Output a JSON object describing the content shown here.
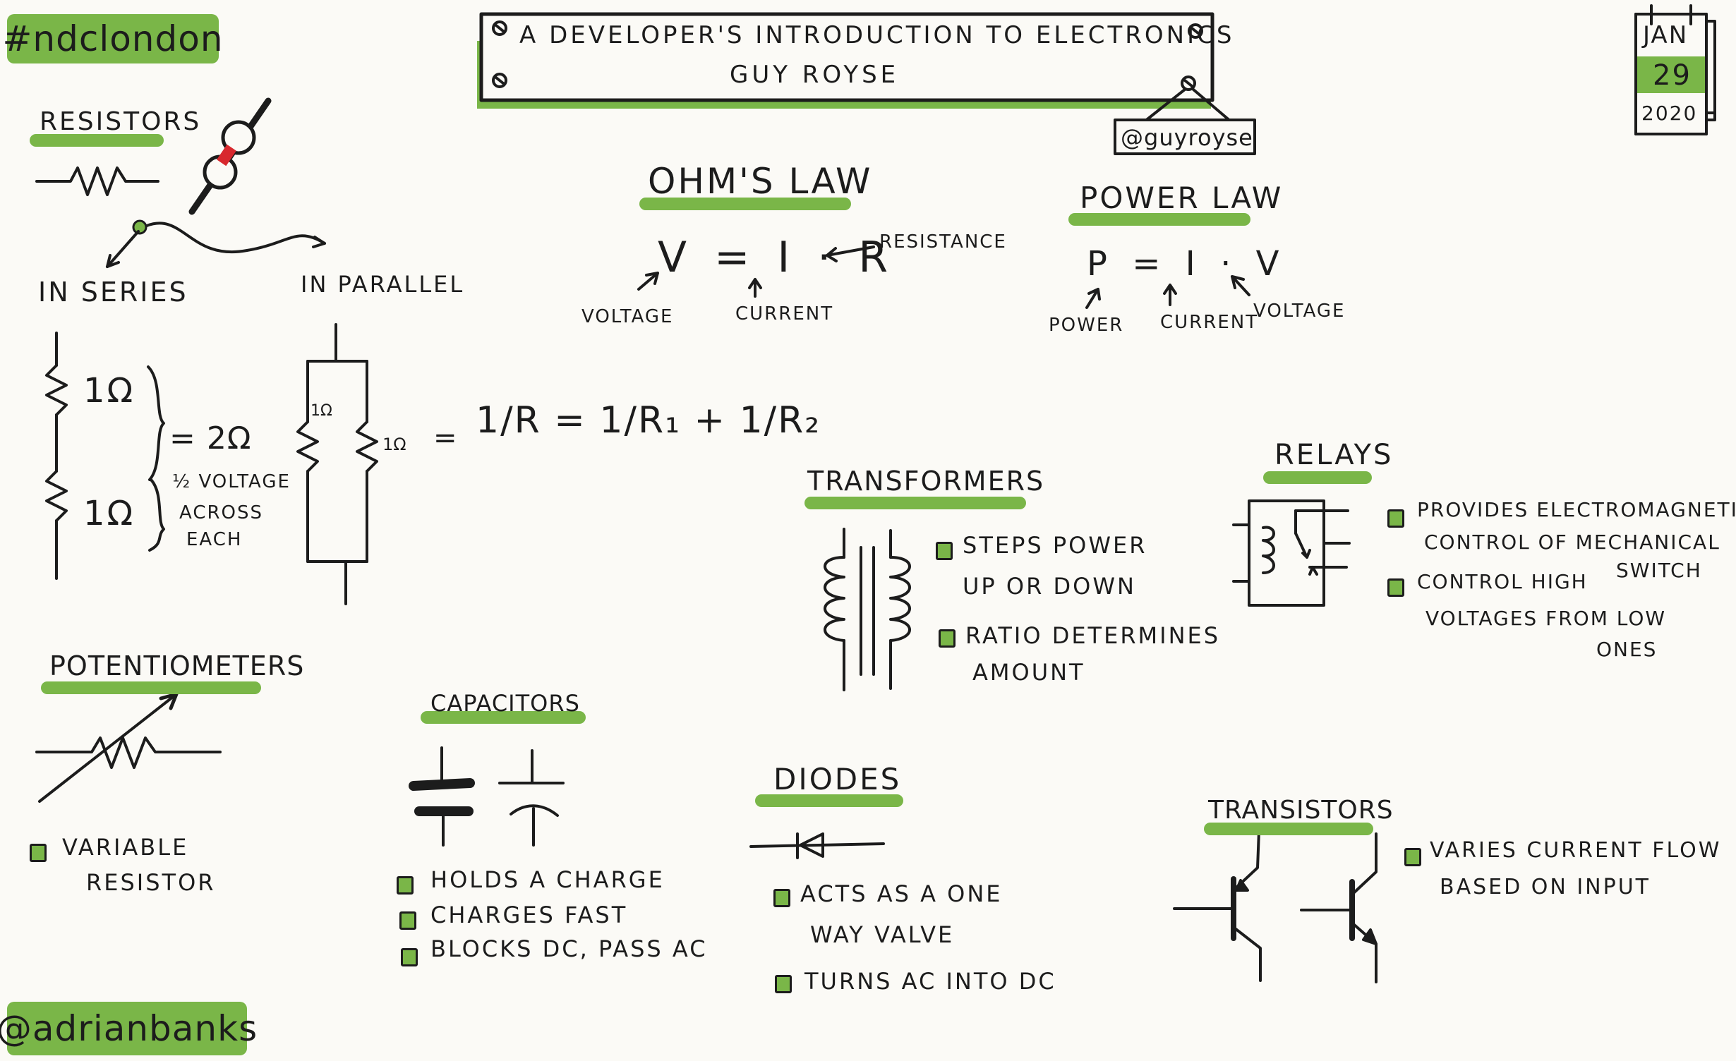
{
  "hashtag": "#ndclondon",
  "author_handle": "@adrianbanks",
  "title": {
    "line1": "A DEVELOPER'S INTRODUCTION TO ELECTRONICS",
    "line2": "GUY ROYSE",
    "speaker_handle": "@guyroyse"
  },
  "date": {
    "month": "JAN",
    "day": "29",
    "year": "2020"
  },
  "resistors": {
    "heading": "RESISTORS",
    "series_label": "IN SERIES",
    "parallel_label": "IN PARALLEL",
    "series_r1": "1Ω",
    "series_r2": "1Ω",
    "series_total": "= 2Ω",
    "series_note": [
      "½ VOLTAGE",
      "ACROSS",
      "EACH"
    ],
    "parallel_r1": "1Ω",
    "parallel_r2": "1Ω",
    "parallel_eq": "=",
    "parallel_formula": "1/R = 1/R₁ + 1/R₂"
  },
  "ohms_law": {
    "heading": "OHM'S LAW",
    "formula": "V = I · R",
    "labels": {
      "voltage": "VOLTAGE",
      "current": "CURRENT",
      "resistance": "RESISTANCE"
    }
  },
  "power_law": {
    "heading": "POWER LAW",
    "formula": "P = I · V",
    "labels": {
      "power": "POWER",
      "current": "CURRENT",
      "voltage": "VOLTAGE"
    }
  },
  "transformers": {
    "heading": "TRANSFORMERS",
    "bullets": [
      [
        "STEPS POWER",
        "UP OR DOWN"
      ],
      [
        "RATIO DETERMINES",
        "AMOUNT"
      ]
    ]
  },
  "relays": {
    "heading": "RELAYS",
    "bullets": [
      [
        "PROVIDES ELECTROMAGNETIC",
        "CONTROL OF MECHANICAL",
        "SWITCH"
      ],
      [
        "CONTROL HIGH",
        "VOLTAGES FROM LOW",
        "ONES"
      ]
    ]
  },
  "potentiometers": {
    "heading": "POTENTIOMETERS",
    "bullets": [
      [
        "VARIABLE",
        "RESISTOR"
      ]
    ]
  },
  "capacitors": {
    "heading": "CAPACITORS",
    "bullets": [
      "HOLDS A CHARGE",
      "CHARGES FAST",
      "BLOCKS DC, PASS AC"
    ]
  },
  "diodes": {
    "heading": "DIODES",
    "bullets": [
      [
        "ACTS AS A ONE",
        "WAY VALVE"
      ],
      [
        "TURNS AC INTO DC"
      ]
    ]
  },
  "transistors": {
    "heading": "TRANSISTORS",
    "bullets": [
      [
        "VARIES CURRENT FLOW",
        "BASED ON INPUT"
      ]
    ]
  },
  "colors": {
    "accent_green": "#7ab648",
    "ink": "#1c1c1c",
    "paper": "#fbfaf6",
    "resistor_band": "#d8282e"
  }
}
